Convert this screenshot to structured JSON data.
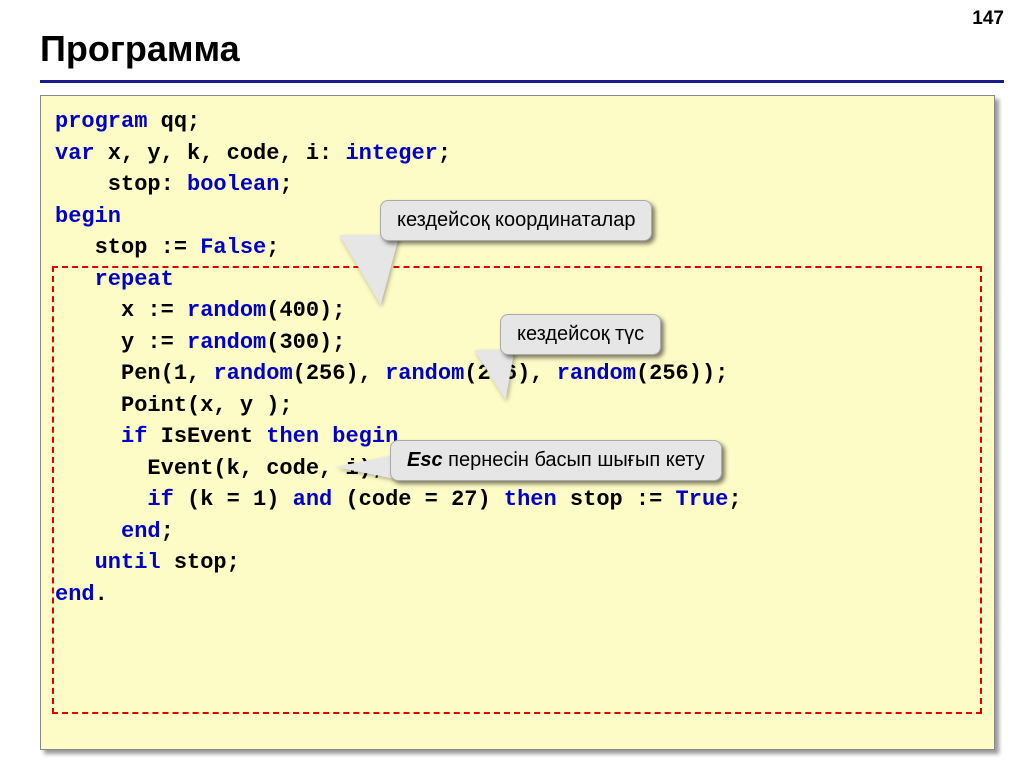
{
  "page_number": "147",
  "title": "Программа",
  "code": {
    "l1a": "program",
    "l1b": " qq;",
    "l2a": "var",
    "l2b": " x, y, k, code, i: ",
    "l2c": "integer",
    "l2d": ";",
    "l3a": "    stop: ",
    "l3b": "boolean",
    "l3c": ";",
    "l4": "begin",
    "l5a": "   stop := ",
    "l5b": "False",
    "l5c": ";",
    "l6": "   repeat",
    "l7a": "     x := ",
    "l7b": "random",
    "l7c": "(400);",
    "l8a": "     y := ",
    "l8b": "random",
    "l8c": "(300);",
    "l9a": "     Pen(1, ",
    "l9b": "random",
    "l9c": "(256), ",
    "l9d": "random",
    "l9e": "(256), ",
    "l9f": "random",
    "l9g": "(256));",
    "l10": "     Point(x, y );",
    "l11a": "     ",
    "l11b": "if",
    "l11c": " IsEvent ",
    "l11d": "then",
    "l11e": " ",
    "l11f": "begin",
    "l12": "       Event(k, code, i);",
    "l13a": "       ",
    "l13b": "if",
    "l13c": " (k = 1) ",
    "l13d": "and",
    "l13e": " (code = 27) ",
    "l13f": "then",
    "l13g": " stop := ",
    "l13h": "True",
    "l13i": ";",
    "l14a": "     ",
    "l14b": "end",
    "l14c": ";",
    "l15a": "   ",
    "l15b": "until",
    "l15c": " stop;",
    "l16a": "end",
    "l16b": "."
  },
  "callouts": {
    "coord": "кездейсоқ координаталар",
    "color": "кездейсоқ түс",
    "esc_kw": "Esc",
    "esc_rest": " пернесін басып шығып кету"
  }
}
